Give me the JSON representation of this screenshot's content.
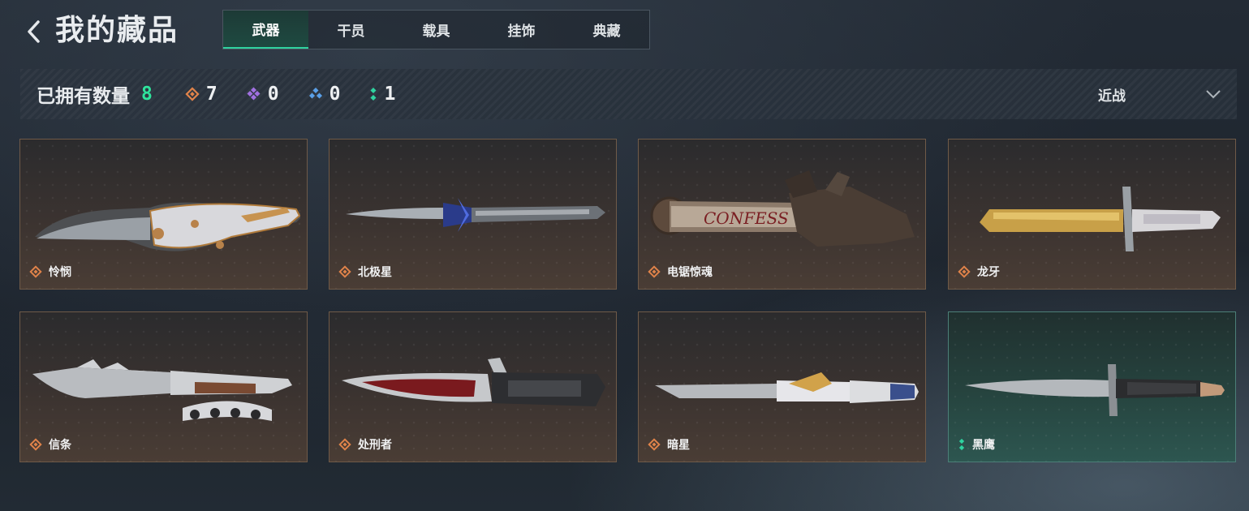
{
  "header": {
    "title": "我的藏品",
    "tabs": [
      {
        "label": "武器",
        "active": true
      },
      {
        "label": "干员",
        "active": false
      },
      {
        "label": "载具",
        "active": false
      },
      {
        "label": "挂饰",
        "active": false
      },
      {
        "label": "典藏",
        "active": false
      }
    ]
  },
  "stats": {
    "owned_label": "已拥有数量",
    "owned_count": "8",
    "rarity_counts": [
      {
        "icon": "orange-diamond-icon",
        "color": "#e0834a",
        "value": "7"
      },
      {
        "icon": "purple-diamond-icon",
        "color": "#a070e0",
        "value": "0"
      },
      {
        "icon": "blue-diamond-icon",
        "color": "#5aa0e8",
        "value": "0"
      },
      {
        "icon": "green-dots-icon",
        "color": "#2fd3a0",
        "value": "1"
      }
    ],
    "filter_label": "近战"
  },
  "items": [
    {
      "name": "怜悯",
      "rarity": "orange"
    },
    {
      "name": "北极星",
      "rarity": "orange"
    },
    {
      "name": "电锯惊魂",
      "rarity": "orange"
    },
    {
      "name": "龙牙",
      "rarity": "orange"
    },
    {
      "name": "信条",
      "rarity": "orange"
    },
    {
      "name": "处刑者",
      "rarity": "orange"
    },
    {
      "name": "暗星",
      "rarity": "orange"
    },
    {
      "name": "黑鹰",
      "rarity": "green"
    }
  ],
  "colors": {
    "accent_green": "#2fd3a0",
    "owned_green": "#2fe39c",
    "rarity_orange": "#e0834a"
  }
}
